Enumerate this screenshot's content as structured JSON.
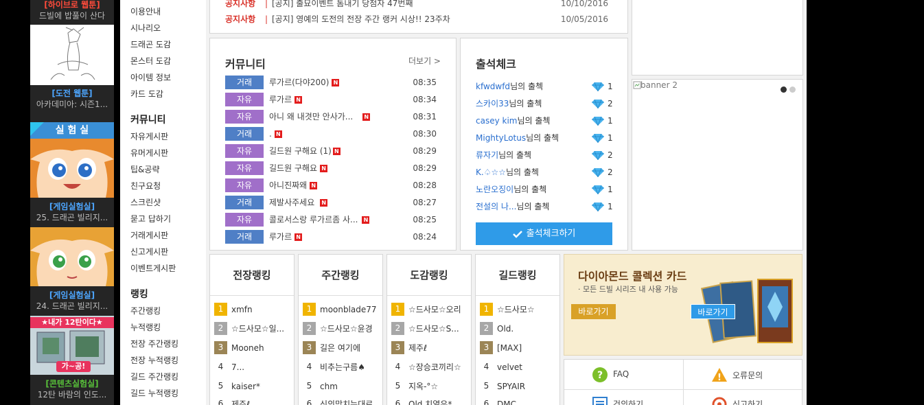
{
  "promo": {
    "b1_title": "[하이브로 웹툰]",
    "b1_sub": "드빌에 밥풀이 산다",
    "b2_title": "[도전 웹툰]",
    "b2_sub": "아카데미아: 시즌1...",
    "lab_title": "실 험 실",
    "b3_title": "[게임실험실]",
    "b3_sub": "25. 드래곤 빌리지...",
    "b4_title": "[게임실험실]",
    "b4_sub": "24. 드래곤 빌리지...",
    "b5_banner": "★내가 12탄이다★",
    "b5_tag": "가~공!",
    "b5_title": "[콘텐츠실험실]",
    "b5_sub": "12탄 바람의 인도..."
  },
  "nav": {
    "g1": [
      "이용안내",
      "시나리오",
      "드래곤 도감",
      "몬스터 도감",
      "아이템 정보",
      "카드 도감"
    ],
    "h2": "커뮤니티",
    "g2": [
      "자유게시판",
      "유머게시판",
      "팁&공략",
      "친구요청",
      "스크린샷",
      "묻고 답하기",
      "거래게시판",
      "신고게시판",
      "이벤트게시판"
    ],
    "h3": "랭킹",
    "g3": [
      "주간랭킹",
      "누적랭킹",
      "전장 주간랭킹",
      "전장 누적랭킹",
      "길드 주간랭킹",
      "길드 누적랭킹"
    ]
  },
  "notice": {
    "rows": [
      {
        "cat": "공지사항",
        "title": "[공지] 출묘이벤트 톰내기 당첨자 47번째",
        "date": "10/10/2016"
      },
      {
        "cat": "공지사항",
        "title": "[공지] 영예의 도전의 전장 주간 랭커 시상!! 23주차",
        "date": "10/05/2016"
      }
    ]
  },
  "community": {
    "title": "커뮤니티",
    "more": "더보기 >",
    "new_badge": "N",
    "posts": [
      {
        "tag": "거래",
        "type": "trade",
        "title": "루가르(다야200)",
        "time": "08:35"
      },
      {
        "tag": "자유",
        "type": "free",
        "title": "루가르",
        "time": "08:34"
      },
      {
        "tag": "자유",
        "type": "free",
        "title": "아니 왜 내겻만 안사가...",
        "time": "08:31"
      },
      {
        "tag": "거래",
        "type": "trade",
        "title": ".",
        "time": "08:30"
      },
      {
        "tag": "자유",
        "type": "free",
        "title": "길드원 구해요 (1)",
        "time": "08:29"
      },
      {
        "tag": "자유",
        "type": "free",
        "title": "길드원 구해요",
        "time": "08:29"
      },
      {
        "tag": "자유",
        "type": "free",
        "title": "아니진짜왜",
        "time": "08:28"
      },
      {
        "tag": "거래",
        "type": "trade",
        "title": "제발사주세요",
        "time": "08:27"
      },
      {
        "tag": "자유",
        "type": "free",
        "title": "콜로서스랑 루가르좀 사...",
        "time": "08:25"
      },
      {
        "tag": "거래",
        "type": "trade",
        "title": "루가르",
        "time": "08:24"
      }
    ]
  },
  "attendance": {
    "title": "출석체크",
    "suffix": "님의 출첵",
    "rows": [
      {
        "nick": "kfwdwfd",
        "count": "1"
      },
      {
        "nick": "스카이33",
        "count": "2"
      },
      {
        "nick": "casey kim",
        "count": "1"
      },
      {
        "nick": "MightyLotus",
        "count": "1"
      },
      {
        "nick": "류자기",
        "count": "2"
      },
      {
        "nick": "K.♤☆☆",
        "count": "2"
      },
      {
        "nick": "노란오징이",
        "count": "1"
      },
      {
        "nick": "전설의 나...",
        "count": "1"
      }
    ],
    "button": "출석체크하기"
  },
  "banner2": {
    "alt": "banner 2"
  },
  "rankings": [
    {
      "title": "전장랭킹",
      "items": [
        "xmfn",
        "☆드사모☆일...",
        "Mooneh",
        "7...",
        "kaiser*",
        "제주ℓ"
      ]
    },
    {
      "title": "주간랭킹",
      "items": [
        "moonblade77",
        "☆드사모☆윤경",
        "길은 여기에",
        "비추는구름♠",
        "chm",
        "신의망치는대로"
      ]
    },
    {
      "title": "도감랭킹",
      "items": [
        "☆드사모☆오리",
        "☆드사모☆S...",
        "제주ℓ",
        "☆장승코끼리☆",
        "지옥-°☆",
        "Old 치열우*"
      ]
    },
    {
      "title": "길드랭킹",
      "items": [
        "☆드사모☆",
        "Old.",
        "[MAX]",
        "velvet",
        "SPYAIR",
        "DMC"
      ]
    }
  ],
  "diamond": {
    "title": "다이아몬드 콜렉션 카드",
    "sub": "· 모든 드빌 시리즈 내 사용 가능",
    "btn1": "바로가기",
    "btn2": "바로가기"
  },
  "support": {
    "faq": "FAQ",
    "error": "오류문의",
    "suggest": "건의하기",
    "report": "신고하기"
  },
  "colors": {
    "accent_blue": "#2f9be8",
    "notice_red": "#d9332b",
    "diamond_gold": "#d9a127"
  }
}
